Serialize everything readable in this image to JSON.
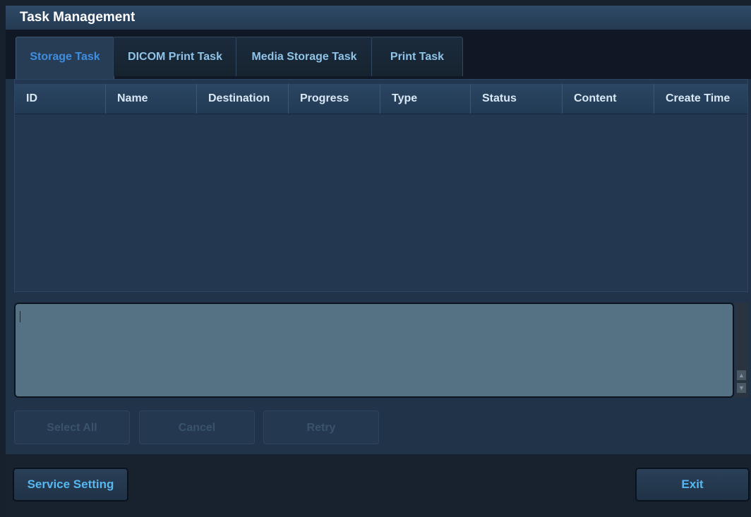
{
  "window": {
    "title": "Task Management"
  },
  "tabs": [
    {
      "label": "Storage Task",
      "active": true
    },
    {
      "label": "DICOM Print Task",
      "active": false
    },
    {
      "label": "Media Storage Task",
      "active": false
    },
    {
      "label": "Print Task",
      "active": false
    }
  ],
  "table": {
    "columns": [
      "ID",
      "Name",
      "Destination",
      "Progress",
      "Type",
      "Status",
      "Content",
      "Create Time"
    ],
    "rows": []
  },
  "log": {
    "text": ""
  },
  "actions": {
    "select_all": "Select All",
    "cancel": "Cancel",
    "retry": "Retry"
  },
  "footer": {
    "service_setting": "Service Setting",
    "exit": "Exit"
  },
  "colors": {
    "accent": "#58b6f0",
    "active_tab": "#3f8ee0",
    "background": "#213348"
  }
}
